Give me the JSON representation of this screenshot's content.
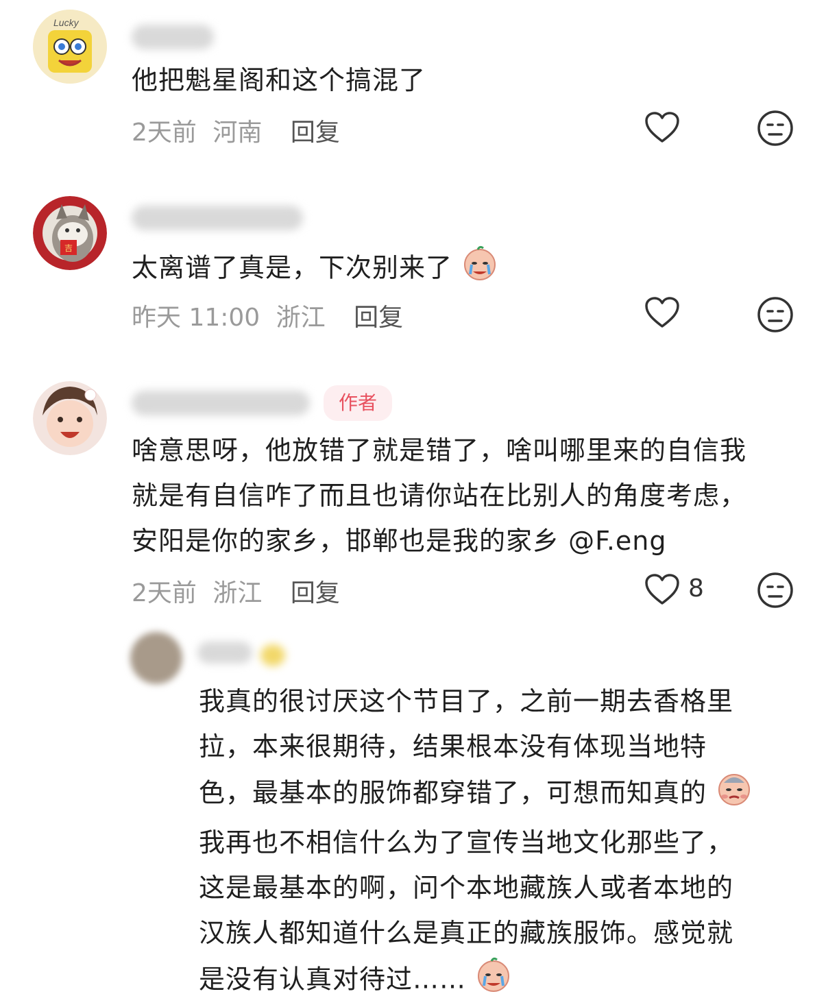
{
  "comments": [
    {
      "text": "他把魁星阁和这个搞混了",
      "time": "2天前",
      "location": "河南",
      "reply_label": "回复",
      "avatar_icon": "spongebob-avatar",
      "avatar_text": "Lucky"
    },
    {
      "text": "太离谱了真是，下次别来了",
      "time": "昨天 11:00",
      "location": "浙江",
      "reply_label": "回复",
      "avatar_icon": "cat-avatar",
      "emoji": "crying-face-emoji"
    },
    {
      "author_badge": "作者",
      "lines": [
        "啥意思呀，他放错了就是错了，啥叫哪里来的自信我",
        "就是有自信咋了而且也请你站在比别人的角度考虑，",
        "安阳是你的家乡，邯郸也是我的家乡 @F.eng"
      ],
      "time": "2天前",
      "location": "浙江",
      "reply_label": "回复",
      "like_count": "8",
      "avatar_icon": "child-avatar"
    },
    {
      "lines": [
        "我真的很讨厌这个节目了，之前一期去香格里",
        "拉，本来很期待，结果根本没有体现当地特",
        "色，最基本的服饰都穿错了，可想而知真的",
        "我再也不相信什么为了宣传当地文化那些了，",
        "这是最基本的啊，问个本地藏族人或者本地的",
        "汉族人都知道什么是真正的藏族服饰。感觉就",
        "是没有认真对待过……"
      ],
      "avatar_icon": "blurred-avatar"
    }
  ],
  "colors": {
    "badge_bg": "#fdeef0",
    "badge_text": "#e8515f",
    "meta_text": "#9a9a9a",
    "icon_stroke": "#333333"
  }
}
